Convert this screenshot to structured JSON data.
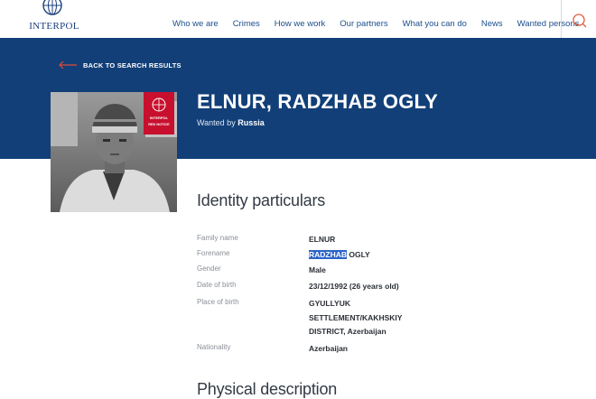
{
  "header": {
    "logo_text": "INTERPOL",
    "nav": [
      "Who we are",
      "Crimes",
      "How we work",
      "Our partners",
      "What you can do",
      "News",
      "Wanted persons"
    ]
  },
  "banner": {
    "back_label": "BACK TO SEARCH RESULTS",
    "person_name": "ELNUR, RADZHAB OGLY",
    "wanted_prefix": "Wanted by",
    "wanted_by": "Russia",
    "notice_brand": "INTERPOL",
    "notice_label": "RED NOTICE"
  },
  "identity": {
    "title": "Identity particulars",
    "rows": [
      {
        "label": "Family name",
        "value": "ELNUR"
      },
      {
        "label": "Forename",
        "value_highlight": "RADZHAB",
        "value_rest": " OGLY"
      },
      {
        "label": "Gender",
        "value": "Male"
      },
      {
        "label": "Date of birth",
        "value": "23/12/1992 (26 years old)"
      },
      {
        "label": "Place of birth",
        "value": "GYULLYUK SETTLEMENT/KAKHSKIY DISTRICT, Azerbaijan"
      },
      {
        "label": "Nationality",
        "value": "Azerbaijan"
      }
    ]
  },
  "physical": {
    "title": "Physical description"
  },
  "colors": {
    "banner_blue": "#123f78",
    "nav_link": "#1b4f8c",
    "notice_red": "#c8102e",
    "selection": "#2b63c7",
    "search_icon": "#e0603c"
  }
}
